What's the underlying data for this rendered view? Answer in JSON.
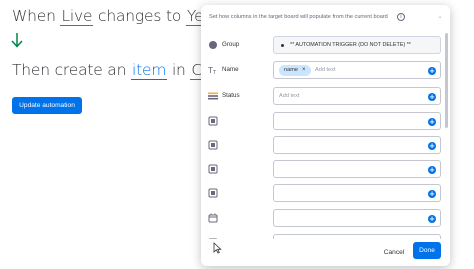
{
  "background": {
    "line1": {
      "prefix": "When",
      "field1": "Live",
      "middle": "changes to",
      "field2": "Yes"
    },
    "line2": {
      "prefix": "Then create an",
      "field1": "item",
      "middle": "in",
      "field2": "Campai"
    },
    "update_button": "Update automation"
  },
  "modal": {
    "header_text": "Set how columns in the target board will populate from the current board",
    "info_icon": "info-icon",
    "rows": [
      {
        "label": "Group",
        "icon": "group-dot-icon",
        "value": "** AUTOMATION TRIGGER (DO NOT DELETE) **"
      },
      {
        "label": "Name",
        "icon": "text-column-icon",
        "chip": "name",
        "chip_remove": "×",
        "placeholder": "Add text"
      },
      {
        "label": "Status",
        "icon": "status-column-icon",
        "placeholder": "Add text"
      },
      {
        "label": "",
        "icon": "column-icon"
      },
      {
        "label": "",
        "icon": "column-icon"
      },
      {
        "label": "",
        "icon": "column-icon"
      },
      {
        "label": "",
        "icon": "column-icon"
      },
      {
        "label": "",
        "icon": "date-column-icon"
      }
    ],
    "cancel_label": "Cancel",
    "done_label": "Done"
  },
  "colors": {
    "accent": "#0073ea",
    "chip": "#cce5ff",
    "text": "#323338",
    "muted": "#676879"
  }
}
